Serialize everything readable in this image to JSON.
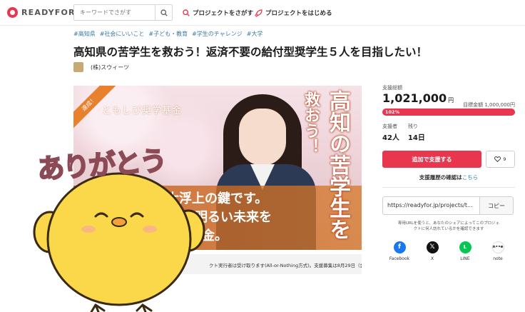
{
  "header": {
    "logo_text": "READYFOR",
    "search_placeholder": "キーワードでさがす",
    "nav_find": "プロジェクトをさがす",
    "nav_start": "プロジェクトをはじめる"
  },
  "project": {
    "tags": [
      "#高知県",
      "#社会にいいこと",
      "#子ども・教育",
      "#学生のチャレンジ",
      "#大学"
    ],
    "title": "高知県の苦学生を救おう！返済不要の給付型奨学生５人を目指したい！",
    "owner": "(株)スウィーツ"
  },
  "hero": {
    "ribbon": "達成！",
    "foundation": "ともしび奨学基金",
    "vertical_1": "高知の苦学生を",
    "vertical_2": "救おう！",
    "line_1": "大浮上の鍵です。",
    "line_2": "にも明るい未来を",
    "line_3": "金。"
  },
  "notice": "クト実行者は受け取ります(All-or-Nothing方式)。支援募集は8月29日（金）午",
  "stats": {
    "total_label": "支援総額",
    "total_value": "1,021,000",
    "yen": "円",
    "goal_label": "目標金額",
    "goal_value": "1,000,000円",
    "percent_text": "102%",
    "percent": 102,
    "supporters_label": "支援者",
    "supporters_value": "42人",
    "remaining_label": "残り",
    "remaining_value": "14日"
  },
  "actions": {
    "support_button": "追加で支援する",
    "favorite_count": "9",
    "history_text": "支援履歴の確認は",
    "history_link": "こちら"
  },
  "share": {
    "url": "https://readyfor.jp/projects/t...",
    "copy_button": "コピー",
    "note_line1": "専用URLを使うと、あなたのシェアによってこのプロジェ",
    "note_line2": "クトに何人訪れているかを確認できます",
    "sns": [
      {
        "name": "Facebook",
        "color": "#1877f2",
        "glyph": "f"
      },
      {
        "name": "X",
        "color": "#111111",
        "glyph": "𝕏"
      },
      {
        "name": "LINE",
        "color": "#06c755",
        "glyph": "L"
      },
      {
        "name": "note",
        "color": "#ffffff",
        "glyph": "n••e"
      }
    ]
  },
  "sticker": {
    "text": "ありがとう"
  }
}
